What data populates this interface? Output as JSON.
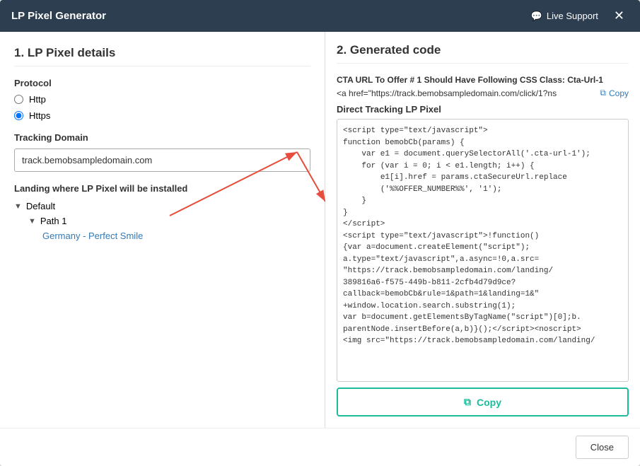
{
  "header": {
    "title": "LP Pixel Generator",
    "live_support": "Live Support",
    "close_label": "✕"
  },
  "left": {
    "section_title": "1. LP Pixel details",
    "protocol_label": "Protocol",
    "protocol_options": [
      "Http",
      "Https"
    ],
    "protocol_selected": "Https",
    "tracking_domain_label": "Tracking Domain",
    "tracking_domain_value": "track.bemobsampledomain.com",
    "tracking_domain_placeholder": "track.bemobsampledomain.com",
    "landing_label": "Landing where LP Pixel will be installed",
    "tree": {
      "default": "Default",
      "path": "Path 1",
      "landing": "Germany - Perfect Smile"
    }
  },
  "right": {
    "section_title": "2. Generated code",
    "cta_label": "CTA URL To Offer # 1 Should Have Following CSS Class: Cta-Url-1",
    "cta_url": "<a href=\"https://track.bemobsampledomain.com/click/1?ns",
    "copy_inline_label": "Copy",
    "direct_tracking_label": "Direct Tracking LP Pixel",
    "code_content": "<script type=\"text/javascript\">\nfunction bemobCb(params) {\n    var e1 = document.querySelectorAll('.cta-url-1');\n    for (var i = 0; i < e1.length; i++) {\n        e1[i].href = params.ctaSecureUrl.replace\n        ('%%OFFER_NUMBER%%', '1');\n    }\n}\n</script>\n<script type=\"text/javascript\">!function()\n{var a=document.createElement(\"script\");\na.type=\"text/javascript\",a.async=!0,a.src=\n\"https://track.bemobsampledomain.com/landing/\n389816a6-f575-449b-b811-2cfb4d79d9ce?\ncallback=bemobCb&rule=1&path=1&landing=1&\"\n+window.location.search.substring(1);\nvar b=document.getElementsByTagName(\"script\")[0];b.\nparentNode.insertBefore(a,b)}();</script><noscript>\n<img src=\"https://track.bemobsampledomain.com/landing/",
    "copy_button_label": "Copy"
  },
  "footer": {
    "close_label": "Close"
  },
  "icons": {
    "chat": "💬",
    "copy": "⧉",
    "arrow_down": "▼",
    "arrow_right": "►"
  }
}
